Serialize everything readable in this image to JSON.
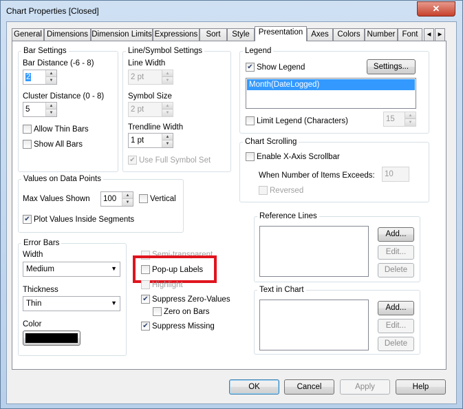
{
  "window": {
    "title": "Chart Properties [Closed]",
    "close_glyph": "✕"
  },
  "tabs": [
    "General",
    "Dimensions",
    "Dimension Limits",
    "Expressions",
    "Sort",
    "Style",
    "Presentation",
    "Axes",
    "Colors",
    "Number",
    "Font"
  ],
  "tab_scroll": {
    "left": "◂",
    "right": "▸"
  },
  "bar_settings": {
    "title": "Bar Settings",
    "bar_distance_label": "Bar Distance (-6 - 8)",
    "bar_distance_value": "2",
    "cluster_distance_label": "Cluster Distance (0 - 8)",
    "cluster_distance_value": "5",
    "allow_thin_bars": "Allow Thin Bars",
    "show_all_bars": "Show All Bars"
  },
  "line_symbol": {
    "title": "Line/Symbol Settings",
    "line_width_label": "Line Width",
    "line_width_value": "2 pt",
    "symbol_size_label": "Symbol Size",
    "symbol_size_value": "2 pt",
    "trendline_width_label": "Trendline Width",
    "trendline_width_value": "1 pt",
    "use_full_symbol_set": "Use Full Symbol Set"
  },
  "values_on_points": {
    "title": "Values on Data Points",
    "max_values_label": "Max Values Shown",
    "max_values_value": "100",
    "vertical": "Vertical",
    "plot_inside": "Plot Values Inside Segments"
  },
  "error_bars": {
    "title": "Error Bars",
    "width_label": "Width",
    "width_value": "Medium",
    "thickness_label": "Thickness",
    "thickness_value": "Thin",
    "color_label": "Color",
    "color_value": "#000000"
  },
  "misc": {
    "semi_transparent": "Semi-transparent",
    "popup_labels": "Pop-up Labels",
    "highlight": "Highlight",
    "suppress_zero": "Suppress Zero-Values",
    "zero_on_bars": "Zero on Bars",
    "suppress_missing": "Suppress Missing"
  },
  "legend": {
    "title": "Legend",
    "show_legend": "Show Legend",
    "settings_button": "Settings...",
    "items": [
      "Month(DateLogged)"
    ],
    "limit_legend": "Limit Legend (Characters)",
    "limit_value": "15"
  },
  "scrolling": {
    "title": "Chart Scrolling",
    "enable_scrollbar": "Enable X-Axis Scrollbar",
    "when_exceeds_label": "When Number of Items Exceeds:",
    "when_exceeds_value": "10",
    "reversed": "Reversed"
  },
  "reference_lines": {
    "title": "Reference Lines",
    "add": "Add...",
    "edit": "Edit...",
    "delete": "Delete"
  },
  "text_in_chart": {
    "title": "Text in Chart",
    "add": "Add...",
    "edit": "Edit...",
    "delete": "Delete"
  },
  "footer": {
    "ok": "OK",
    "cancel": "Cancel",
    "apply": "Apply",
    "help": "Help"
  },
  "colors": {
    "highlight_box": "#e0141e",
    "selection": "#3399ff"
  }
}
